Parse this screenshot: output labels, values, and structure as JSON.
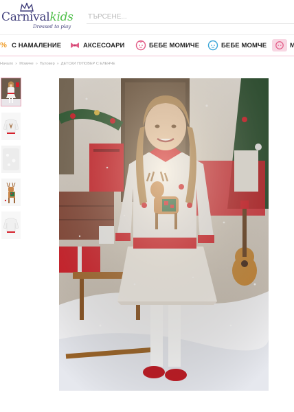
{
  "brand": {
    "name_part1": "Carnival",
    "name_part2": "kids",
    "tagline": "Dressed to play"
  },
  "search": {
    "placeholder": "ТЪРСЕНЕ..."
  },
  "nav": {
    "items": [
      {
        "label": "С НАМАЛЕНИЕ",
        "icon": "percent-icon"
      },
      {
        "label": "АКСЕСОАРИ",
        "icon": "bow-icon"
      },
      {
        "label": "БЕБЕ МОМИЧЕ",
        "icon": "baby-girl-icon"
      },
      {
        "label": "БЕБЕ МОМЧЕ",
        "icon": "baby-boy-icon"
      },
      {
        "label": "М",
        "icon": "girl-icon"
      }
    ]
  },
  "breadcrumb": {
    "items": [
      "Начало",
      "Момиче",
      "Пуловер",
      "ДЕТСКИ ПУЛОВЕР С ЕЛЕНЧЕ"
    ],
    "separator": "»"
  },
  "gallery": {
    "thumbnails": [
      {
        "name": "thumb-girl-photo",
        "active": true
      },
      {
        "name": "thumb-sweater-front"
      },
      {
        "name": "thumb-sweater-texture"
      },
      {
        "name": "thumb-reindeer-detail"
      },
      {
        "name": "thumb-sweater-back"
      }
    ]
  },
  "colors": {
    "nav_underline": "#f3c1d1",
    "accent_pink": "#e25b86",
    "brand_navy": "#3f3d7a",
    "brand_green": "#4fbf4a",
    "sweater_red": "#d6202b"
  }
}
